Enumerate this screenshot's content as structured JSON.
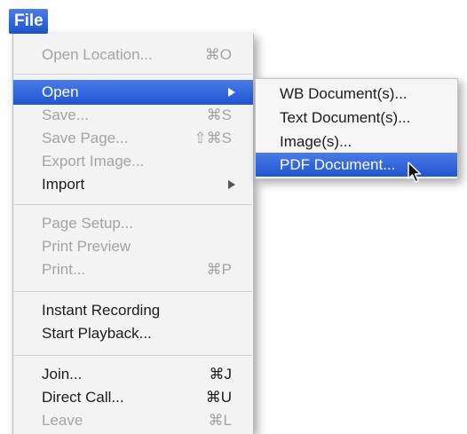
{
  "menubar": {
    "file_label": "File"
  },
  "file_menu": {
    "items": [
      {
        "label": "Open Location...",
        "shortcut": "⌘O",
        "state": "disabled"
      },
      {
        "label": "Open",
        "shortcut": "",
        "state": "highlight",
        "submenu": true
      },
      {
        "label": "Save...",
        "shortcut": "⌘S",
        "state": "disabled"
      },
      {
        "label": "Save Page...",
        "shortcut": "⇧⌘S",
        "state": "disabled"
      },
      {
        "label": "Export Image...",
        "shortcut": "",
        "state": "disabled"
      },
      {
        "label": "Import",
        "shortcut": "",
        "state": "enabled",
        "submenu": true
      },
      {
        "label": "Page Setup...",
        "shortcut": "",
        "state": "disabled"
      },
      {
        "label": "Print Preview",
        "shortcut": "",
        "state": "disabled"
      },
      {
        "label": "Print...",
        "shortcut": "⌘P",
        "state": "disabled"
      },
      {
        "label": "Instant Recording",
        "shortcut": "",
        "state": "enabled"
      },
      {
        "label": "Start Playback...",
        "shortcut": "",
        "state": "enabled"
      },
      {
        "label": "Join...",
        "shortcut": "⌘J",
        "state": "enabled"
      },
      {
        "label": "Direct Call...",
        "shortcut": "⌘U",
        "state": "enabled"
      },
      {
        "label": "Leave",
        "shortcut": "⌘L",
        "state": "disabled"
      }
    ]
  },
  "open_submenu": {
    "items": [
      {
        "label": "WB Document(s)...",
        "state": "enabled"
      },
      {
        "label": "Text Document(s)...",
        "state": "enabled"
      },
      {
        "label": "Image(s)...",
        "state": "enabled"
      },
      {
        "label": "PDF Document...",
        "state": "highlight"
      }
    ]
  },
  "colors": {
    "highlight": "#1f55d3",
    "menu_background": "#f3f3f3",
    "disabled_text": "#a3a3a3"
  },
  "icons": {
    "cursor": "arrow-cursor-icon",
    "submenu": "submenu-arrow-icon"
  }
}
